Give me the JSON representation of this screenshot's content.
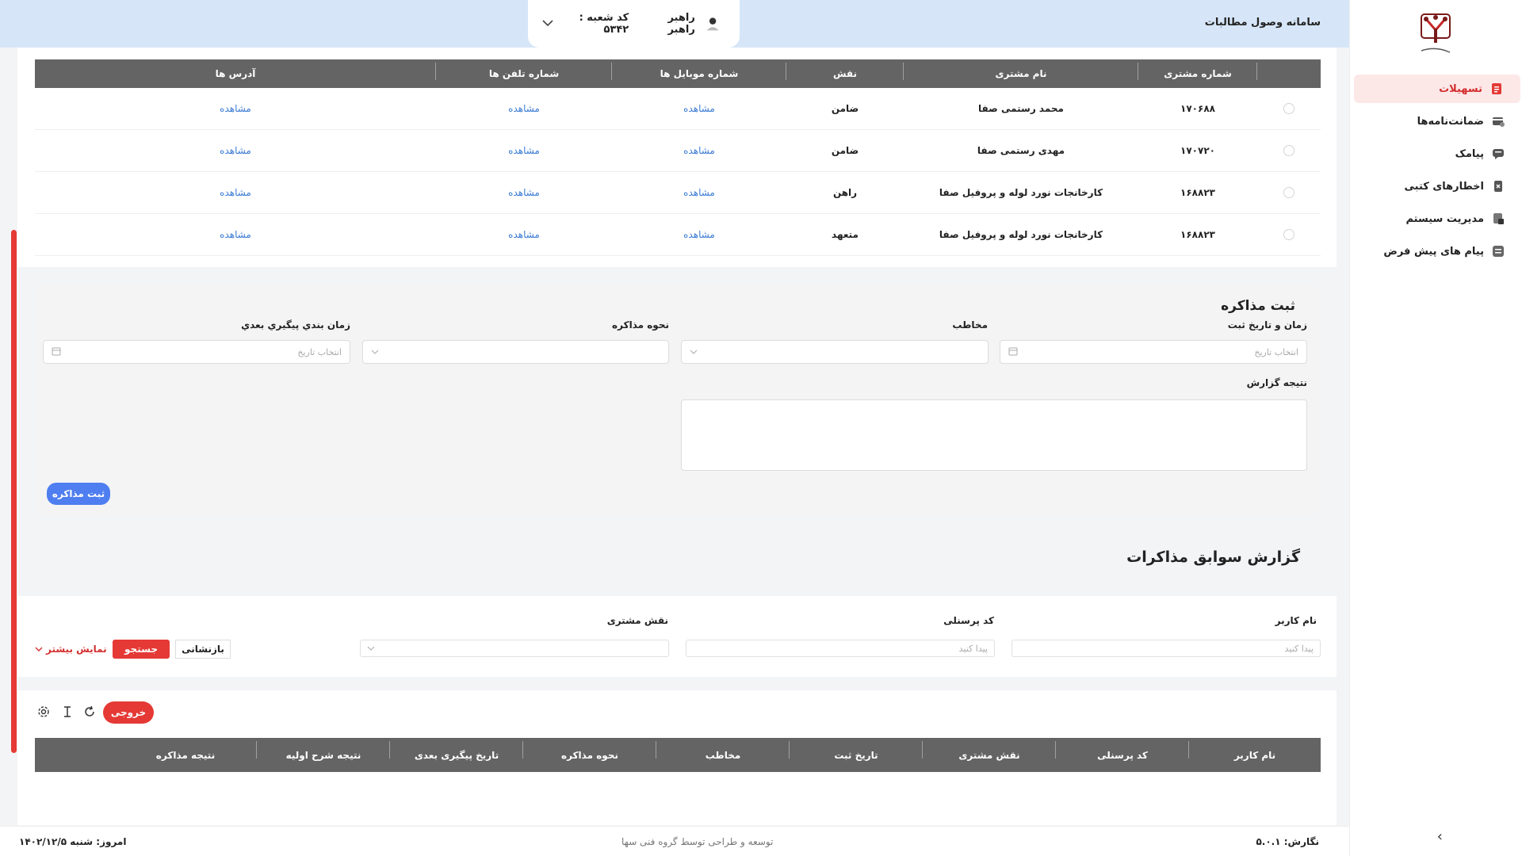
{
  "app": {
    "title": "سامانه وصول مطالبات"
  },
  "user": {
    "name": "راهبر راهبر",
    "branch": "کد شعبه : ۵۳۴۲"
  },
  "sidebar": {
    "items": [
      {
        "label": "تسهیلات",
        "icon": "facilities-icon"
      },
      {
        "label": "ضمانت‌نامه‌ها",
        "icon": "guarantee-icon"
      },
      {
        "label": "پیامک",
        "icon": "sms-icon"
      },
      {
        "label": "اخطارهای کتبی",
        "icon": "warning-letter-icon"
      },
      {
        "label": "مدیریت سیستم",
        "icon": "system-management-icon"
      },
      {
        "label": "پیام های پیش فرض",
        "icon": "default-messages-icon"
      }
    ]
  },
  "customers": {
    "headers": [
      "شماره مشتری",
      "نام مشتری",
      "نقش",
      "شماره موبایل ها",
      "شماره تلفن ها",
      "آدرس ها"
    ],
    "rows": [
      {
        "id": "۱۷۰۶۸۸",
        "name": "محمد رستمی صفا",
        "role": "ضامن",
        "mobile": "مشاهده",
        "phone": "مشاهده",
        "address": "مشاهده"
      },
      {
        "id": "۱۷۰۷۲۰",
        "name": "مهدی رستمی صفا",
        "role": "ضامن",
        "mobile": "مشاهده",
        "phone": "مشاهده",
        "address": "مشاهده"
      },
      {
        "id": "۱۶۸۸۲۳",
        "name": "کارخانجات نورد لوله و پروفیل صفا",
        "role": "راهن",
        "mobile": "مشاهده",
        "phone": "مشاهده",
        "address": "مشاهده"
      },
      {
        "id": "۱۶۸۸۲۳",
        "name": "کارخانجات نورد لوله و پروفیل صفا",
        "role": "متعهد",
        "mobile": "مشاهده",
        "phone": "مشاهده",
        "address": "مشاهده"
      }
    ]
  },
  "form": {
    "title": "ثبت مذاکره",
    "date_label": "زمان و تاریخ ثبت",
    "date_placeholder": "انتخاب تاریخ",
    "contact_label": "مخاطب",
    "method_label": "نحوه مذاکره",
    "followup_label": "زمان بندي پيگيري بعدي",
    "followup_placeholder": "انتخاب تاریخ",
    "result_label": "نتیجه گزارش",
    "submit": "ثبت مذاکره"
  },
  "history": {
    "title": "گزارش سوابق مذاکرات",
    "user_label": "نام کاربر",
    "user_placeholder": "پیدا کنید",
    "personnel_label": "کد پرسنلی",
    "personnel_placeholder": "پیدا کنید",
    "role_label": "نقش مشتری",
    "reset": "بازنشانی",
    "search": "جستجو",
    "more": "نمایش بیشتر",
    "export": "خروجی",
    "headers": [
      "نام کاربر",
      "کد پرسنلی",
      "نقش مشتری",
      "تاریخ ثبت",
      "مخاطب",
      "نحوه مذاکره",
      "تاریخ پیگیری بعدی",
      "نتیجه شرح اولیه",
      "نتیجه مذاکره"
    ]
  },
  "footer": {
    "version": "نگارش: ۵.۰.۱",
    "credit": "توسعه و طراحی توسط گروه فنی سها",
    "today": "امروز: شنبه ۱۴۰۲/۱۲/۵"
  },
  "colors": {
    "accent_red": "#e53935",
    "accent_blue": "#4f7ef0",
    "header_bg": "#d6e6f8",
    "table_head": "#646464"
  }
}
